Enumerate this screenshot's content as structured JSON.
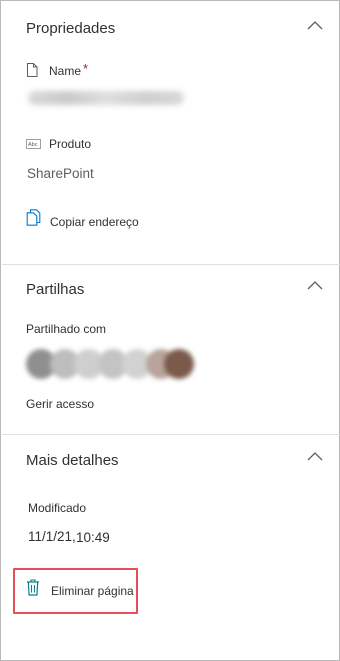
{
  "properties": {
    "title": "Propriedades",
    "name_label": "Name",
    "required_mark": "*",
    "product_label": "Produto",
    "product_value": "SharePoint",
    "copy_address": "Copiar endereço"
  },
  "sharing": {
    "title": "Partilhas",
    "shared_with_label": "Partilhado com",
    "manage_access": "Gerir acesso"
  },
  "details": {
    "title": "Mais detalhes",
    "modified_label": "Modificado",
    "modified_date": "11/1/21,",
    "modified_time": "10:49",
    "delete_page": "Eliminar página"
  },
  "colors": {
    "accent": "#0078d4",
    "required": "#a4262c",
    "highlight": "#e74c5a",
    "delete_icon": "#038387"
  }
}
